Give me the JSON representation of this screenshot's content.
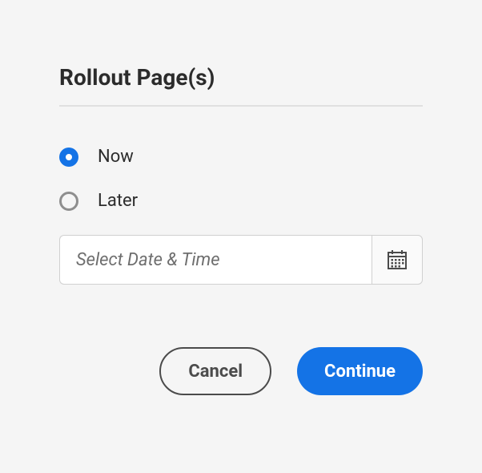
{
  "dialog": {
    "title": "Rollout Page(s)"
  },
  "schedule": {
    "options": [
      {
        "label": "Now",
        "selected": true
      },
      {
        "label": "Later",
        "selected": false
      }
    ],
    "datetime": {
      "placeholder": "Select Date & Time",
      "value": ""
    }
  },
  "actions": {
    "cancel": "Cancel",
    "continue": "Continue"
  }
}
